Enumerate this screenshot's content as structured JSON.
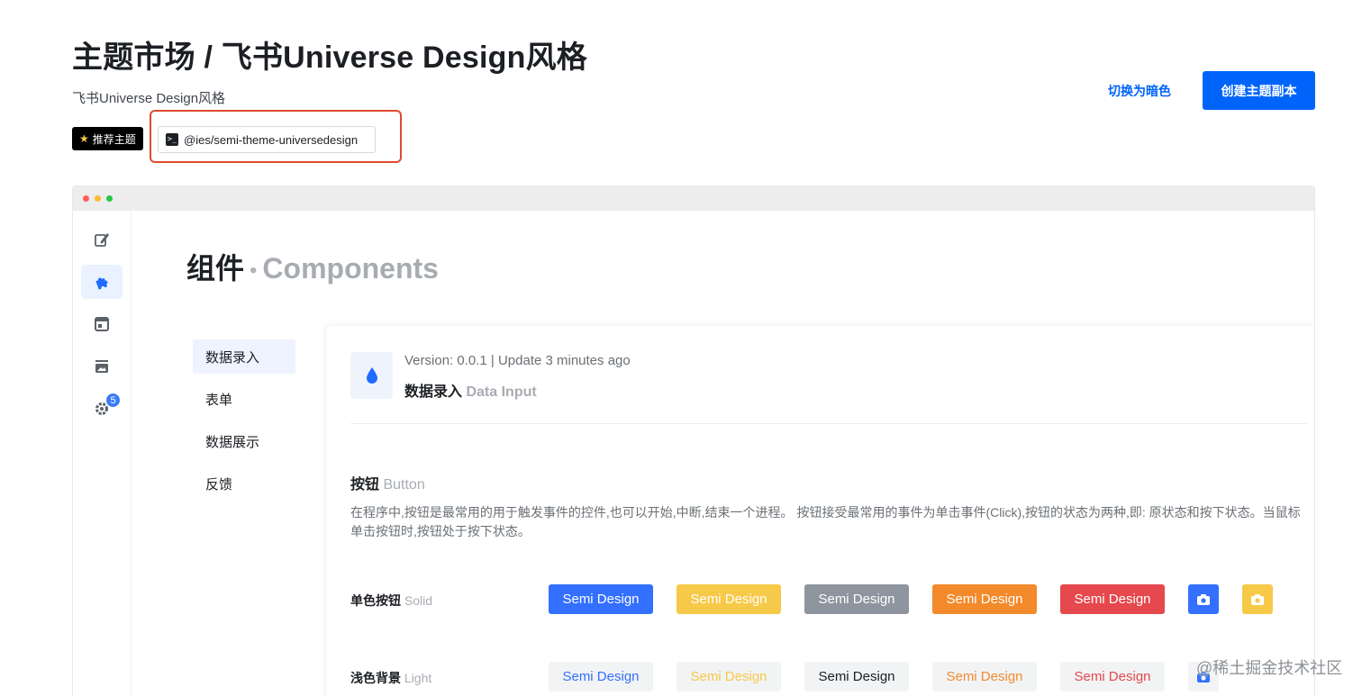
{
  "header": {
    "title": "主题市场 / 飞书Universe Design风格",
    "subtitle": "飞书Universe Design风格",
    "tag_recommend": "推荐主题",
    "package_name": "@ies/semi-theme-universedesign",
    "toggle_dark_label": "切换为暗色",
    "create_copy_label": "创建主题副本"
  },
  "preview": {
    "heading_cn": "组件",
    "heading_sep": "•",
    "heading_en": "Components",
    "sidebar": {
      "items": [
        {
          "icon": "edit-icon"
        },
        {
          "icon": "puzzle-icon",
          "active": true
        },
        {
          "icon": "layout-icon"
        },
        {
          "icon": "image-icon"
        },
        {
          "icon": "gear-icon",
          "badge": "5"
        }
      ]
    },
    "sub_nav": [
      {
        "label": "数据录入",
        "active": true
      },
      {
        "label": "表单"
      },
      {
        "label": "数据展示"
      },
      {
        "label": "反馈"
      }
    ],
    "card": {
      "version_text": "Version: 0.0.1 | Update 3 minutes ago",
      "section_cn": "数据录入",
      "section_en": "Data Input",
      "button_title_cn": "按钮",
      "button_title_en": "Button",
      "button_desc": "在程序中,按钮是最常用的用于触发事件的控件,也可以开始,中断,结束一个进程。 按钮接受最常用的事件为单击事件(Click),按钮的状态为两种,即: 原状态和按下状态。当鼠标单击按钮时,按钮处于按下状态。",
      "rows": [
        {
          "label_cn": "单色按钮",
          "label_en": "Solid",
          "buttons": [
            "Semi Design",
            "Semi Design",
            "Semi Design",
            "Semi Design",
            "Semi Design"
          ]
        },
        {
          "label_cn": "浅色背景",
          "label_en": "Light",
          "buttons": [
            "Semi Design",
            "Semi Design",
            "Semi Design",
            "Semi Design",
            "Semi Design"
          ]
        }
      ]
    }
  },
  "colors": {
    "primary": "#0064fa",
    "blue": "#3370ff",
    "yellow": "#f7c948",
    "grey": "#8f959e",
    "orange": "#f38a2c",
    "red": "#e5484d"
  },
  "watermark": "@稀土掘金技术社区"
}
